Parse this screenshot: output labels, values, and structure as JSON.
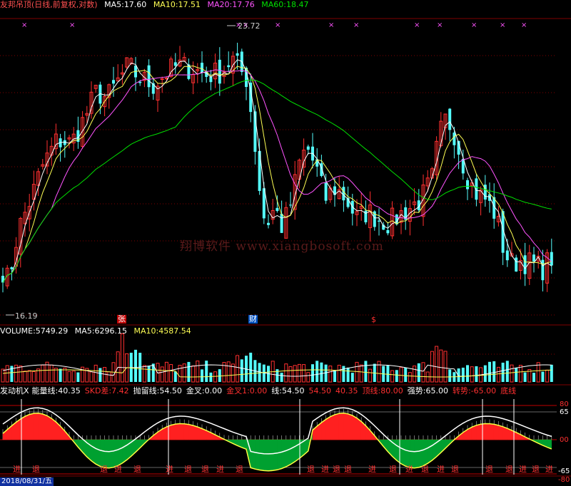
{
  "colors": {
    "up": "#ff3030",
    "down": "#54fcfc",
    "ma5": "#ffffff",
    "ma10": "#ffff54",
    "ma20": "#ff54ff",
    "ma60": "#00e000",
    "grid": "#800000",
    "fill_red": "#ff2020",
    "fill_green": "#00a030"
  },
  "price_header": {
    "name": "友邦吊顶",
    "mode": "(日线,前复权,对数)",
    "ma5_label": "MA5:",
    "ma5": "17.60",
    "ma10_label": "MA10:",
    "ma10": "17.51",
    "ma20_label": "MA20:",
    "ma20": "17.76",
    "ma60_label": "MA60:",
    "ma60": "18.47"
  },
  "price_marks": {
    "high": "23.72",
    "low": "16.19",
    "tag_zhang": "张",
    "tag_cai": "财",
    "tag_s": "$"
  },
  "watermark": "翔博软件 www.xiangbosoft.com",
  "volume_header": {
    "label": "VOLUME:",
    "value": "5749.29",
    "ma5_label": "MA5:",
    "ma5": "6296.15",
    "ma10_label": "MA10:",
    "ma10": "4587.54"
  },
  "ind_header": {
    "name": "发动机X",
    "energy_label": "能量线:",
    "energy": "40.35",
    "skd_label": "SKD差:",
    "skd": "7.42",
    "pl_label": "抛留线:",
    "pl": "54.50",
    "jc_label": "金叉:",
    "jc": "0.00",
    "jc1_label": "金叉1:",
    "jc1": "0.00",
    "xian_label": "线:",
    "xian": "54.50",
    "v1": "54.50",
    "v2": "40.35",
    "dx_label": "顶线:",
    "dx": "80.00",
    "qs_label": "强势:",
    "qs": "65.00",
    "zs_label": "转势:",
    "zs": "-65.00",
    "dix_label": "底线"
  },
  "ind_axis": {
    "t80": "80",
    "t65": "65",
    "t00": "00",
    "tm65": "-65",
    "tm80": "-80"
  },
  "bottom_date": "2018/08/31/五",
  "signals": {
    "jin": "进",
    "tui": "退"
  },
  "chart_data": [
    {
      "type": "candlestick",
      "title": "友邦吊顶",
      "price_range": [
        16.19,
        23.72
      ],
      "ma": {
        "MA5": 17.6,
        "MA10": 17.51,
        "MA20": 17.76,
        "MA60": 18.47
      },
      "scale": "log"
    },
    {
      "type": "bar",
      "title": "VOLUME",
      "last": 5749.29,
      "MA5": 6296.15,
      "MA10": 4587.54
    },
    {
      "type": "area",
      "title": "发动机X",
      "ylim": [
        -80,
        80
      ],
      "levels": [
        80,
        65,
        0,
        -65,
        -80
      ]
    }
  ]
}
